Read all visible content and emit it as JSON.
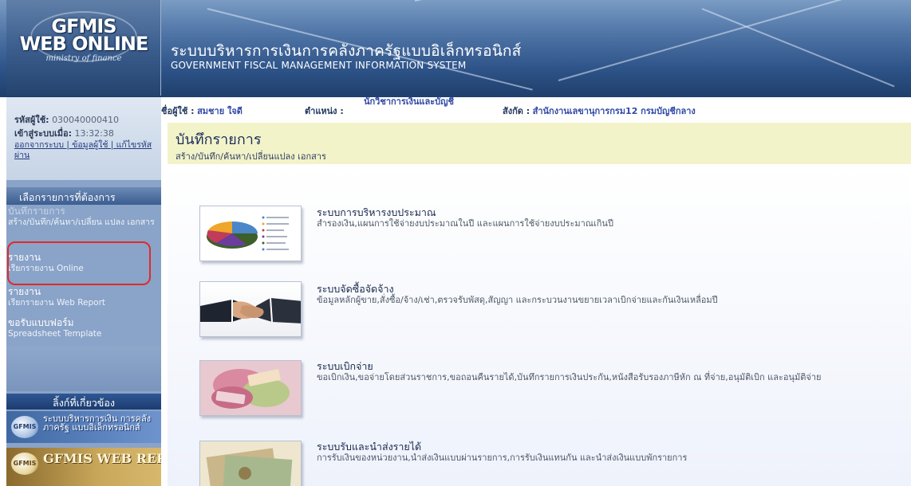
{
  "header": {
    "logo_main": "GFMIS\nWEB ONLINE",
    "logo_sub": "ministry of finance",
    "title_th": "ระบบบริหารการเงินการคลังภาครัฐแบบอิเล็กทรอนิกส์",
    "title_en": "GOVERNMENT FISCAL MANAGEMENT INFORMATION SYSTEM"
  },
  "user": {
    "id_label": "รหัสผู้ใช้:",
    "id_value": "030040000410",
    "login_label": "เข้าสู่ระบบเมื่อ:",
    "login_time": "13:32:38",
    "links": "ออกจากระบบ | ข้อมูลผู้ใช้ | แก้ไขรหัสผ่าน"
  },
  "info": {
    "name_label": "ชื่อผู้ใช้ :",
    "name_value": "สมชาย ใจดี",
    "position_label": "ตำแหน่ง :",
    "position_value": "นักวิชาการเงินและบัญชี",
    "office_label": "สังกัด :",
    "office_value": "สำนักงานเลขานุการกรม12 กรมบัญชีกลาง"
  },
  "sidebar": {
    "menu_header": "เลือกรายการที่ต้องการ",
    "items": [
      {
        "title": "บันทึกรายการ",
        "sub": "สร้าง/บันทึก/ค้นหา/เปลี่ยน แปลง เอกสาร"
      },
      {
        "title": "รายงาน",
        "sub": "เรียกรายงาน Online"
      },
      {
        "title": "รายงาน",
        "sub": "เรียกรายงาน Web Report"
      },
      {
        "title": "ขอรับแบบฟอร์ม",
        "sub": "Spreadsheet Template"
      }
    ],
    "related_header": "ลิ้งก์ที่เกี่ยวข้อง",
    "banners": [
      {
        "logo": "GFMIS",
        "text": "ระบบบริหารการเงิน การคลังภาครัฐ แบบอิเล็กทรอนิกส์"
      },
      {
        "logo": "GFMIS",
        "text": "GFMIS WEB REPORT"
      }
    ]
  },
  "page": {
    "title": "บันทึกรายการ",
    "subtitle": "สร้าง/บันทึก/ค้นหา/เปลี่ยนแปลง เอกสาร"
  },
  "modules": [
    {
      "title": "ระบบการบริหารงบประมาณ",
      "desc": "สำรองเงิน,แผนการใช้จ่ายงบประมาณในปี และแผนการใช้จ่ายงบประมาณเกินปี"
    },
    {
      "title": "ระบบจัดซื้อจัดจ้าง",
      "desc": "ข้อมูลหลักผู้ขาย,สั่งซื้อ/จ้าง/เช่า,ตรวจรับพัสดุ,สัญญา และกระบวนงานขยายเวลาเบิกจ่ายและกันเงินเหลื่อมปี"
    },
    {
      "title": "ระบบเบิกจ่าย",
      "desc": "ขอเบิกเงิน,ขอจ่ายโดยส่วนราชการ,ขอถอนคืนรายได้,บันทึกรายการเงินประกัน,หนังสือรับรองภาษีหัก ณ ที่จ่าย,อนุมัติเบิก และอนุมัติจ่าย"
    },
    {
      "title": "ระบบรับและนำส่งรายได้",
      "desc": "การรับเงินของหน่วยงาน,นำส่งเงินแบบผ่านรายการ,การรับเงินแทนกัน และนำส่งเงินแบบพักรายการ"
    }
  ],
  "colors": {
    "header_blue": "#2e5489",
    "sidebar_blue": "#8aa3c8",
    "title_band": "#f3f3c9",
    "highlight_red": "#e02a2a"
  }
}
